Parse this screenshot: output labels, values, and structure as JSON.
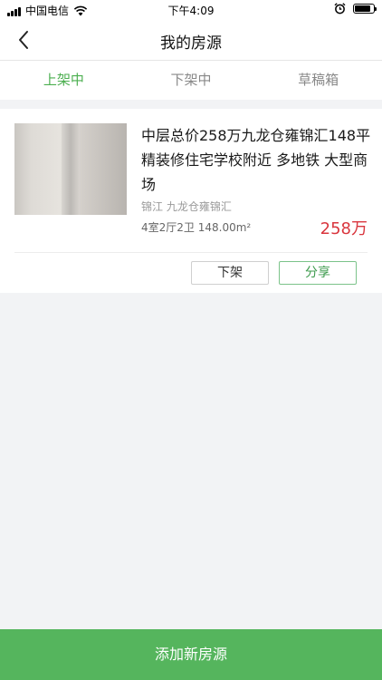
{
  "status_bar": {
    "carrier": "中国电信",
    "time": "下午4:09",
    "battery_level": 0.85
  },
  "nav": {
    "title": "我的房源",
    "back_icon": "chevron-left-icon"
  },
  "tabs": [
    {
      "label": "上架中",
      "active": true
    },
    {
      "label": "下架中",
      "active": false
    },
    {
      "label": "草稿箱",
      "active": false
    }
  ],
  "listing": {
    "title": "中层总价258万九龙仓雍锦汇148平精装修住宅学校附近 多地铁 大型商场",
    "location": "锦江  九龙仓雍锦汇",
    "specs": "4室2厅2卫 148.00m²",
    "price": "258万",
    "delist_label": "下架",
    "share_label": "分享"
  },
  "bottom": {
    "add_label": "添加新房源"
  },
  "colors": {
    "accent": "#4caf50",
    "price": "#d9363e",
    "bottom_button": "#55b55d"
  }
}
